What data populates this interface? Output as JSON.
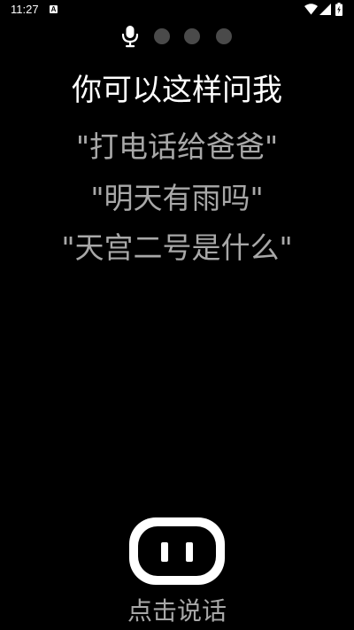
{
  "status_bar": {
    "time": "11:27",
    "notification_icon": "A"
  },
  "icons": {
    "wifi": "wifi-icon",
    "signal": "signal-icon",
    "battery": "battery-icon",
    "mic": "microphone-icon",
    "robot": "robot-face-icon"
  },
  "main": {
    "title": "你可以这样问我",
    "examples": [
      "\"打电话给爸爸\"",
      "\"明天有雨吗\"",
      "\"天宫二号是什么\""
    ]
  },
  "footer": {
    "speak_label": "点击说话"
  },
  "colors": {
    "background": "#000000",
    "title": "#ffffff",
    "example_text": "#a8a8a8",
    "indicator_dot": "#4a4a4a"
  }
}
